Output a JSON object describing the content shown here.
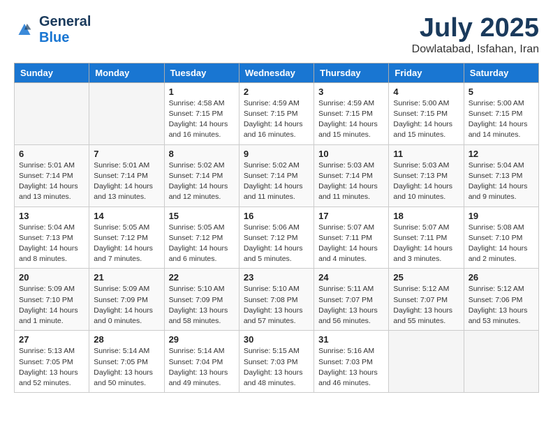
{
  "header": {
    "logo_line1": "General",
    "logo_line2": "Blue",
    "title": "July 2025",
    "subtitle": "Dowlatabad, Isfahan, Iran"
  },
  "days_of_week": [
    "Sunday",
    "Monday",
    "Tuesday",
    "Wednesday",
    "Thursday",
    "Friday",
    "Saturday"
  ],
  "weeks": [
    [
      {
        "day": "",
        "content": ""
      },
      {
        "day": "",
        "content": ""
      },
      {
        "day": "1",
        "content": "Sunrise: 4:58 AM\nSunset: 7:15 PM\nDaylight: 14 hours\nand 16 minutes."
      },
      {
        "day": "2",
        "content": "Sunrise: 4:59 AM\nSunset: 7:15 PM\nDaylight: 14 hours\nand 16 minutes."
      },
      {
        "day": "3",
        "content": "Sunrise: 4:59 AM\nSunset: 7:15 PM\nDaylight: 14 hours\nand 15 minutes."
      },
      {
        "day": "4",
        "content": "Sunrise: 5:00 AM\nSunset: 7:15 PM\nDaylight: 14 hours\nand 15 minutes."
      },
      {
        "day": "5",
        "content": "Sunrise: 5:00 AM\nSunset: 7:15 PM\nDaylight: 14 hours\nand 14 minutes."
      }
    ],
    [
      {
        "day": "6",
        "content": "Sunrise: 5:01 AM\nSunset: 7:14 PM\nDaylight: 14 hours\nand 13 minutes."
      },
      {
        "day": "7",
        "content": "Sunrise: 5:01 AM\nSunset: 7:14 PM\nDaylight: 14 hours\nand 13 minutes."
      },
      {
        "day": "8",
        "content": "Sunrise: 5:02 AM\nSunset: 7:14 PM\nDaylight: 14 hours\nand 12 minutes."
      },
      {
        "day": "9",
        "content": "Sunrise: 5:02 AM\nSunset: 7:14 PM\nDaylight: 14 hours\nand 11 minutes."
      },
      {
        "day": "10",
        "content": "Sunrise: 5:03 AM\nSunset: 7:14 PM\nDaylight: 14 hours\nand 11 minutes."
      },
      {
        "day": "11",
        "content": "Sunrise: 5:03 AM\nSunset: 7:13 PM\nDaylight: 14 hours\nand 10 minutes."
      },
      {
        "day": "12",
        "content": "Sunrise: 5:04 AM\nSunset: 7:13 PM\nDaylight: 14 hours\nand 9 minutes."
      }
    ],
    [
      {
        "day": "13",
        "content": "Sunrise: 5:04 AM\nSunset: 7:13 PM\nDaylight: 14 hours\nand 8 minutes."
      },
      {
        "day": "14",
        "content": "Sunrise: 5:05 AM\nSunset: 7:12 PM\nDaylight: 14 hours\nand 7 minutes."
      },
      {
        "day": "15",
        "content": "Sunrise: 5:05 AM\nSunset: 7:12 PM\nDaylight: 14 hours\nand 6 minutes."
      },
      {
        "day": "16",
        "content": "Sunrise: 5:06 AM\nSunset: 7:12 PM\nDaylight: 14 hours\nand 5 minutes."
      },
      {
        "day": "17",
        "content": "Sunrise: 5:07 AM\nSunset: 7:11 PM\nDaylight: 14 hours\nand 4 minutes."
      },
      {
        "day": "18",
        "content": "Sunrise: 5:07 AM\nSunset: 7:11 PM\nDaylight: 14 hours\nand 3 minutes."
      },
      {
        "day": "19",
        "content": "Sunrise: 5:08 AM\nSunset: 7:10 PM\nDaylight: 14 hours\nand 2 minutes."
      }
    ],
    [
      {
        "day": "20",
        "content": "Sunrise: 5:09 AM\nSunset: 7:10 PM\nDaylight: 14 hours\nand 1 minute."
      },
      {
        "day": "21",
        "content": "Sunrise: 5:09 AM\nSunset: 7:09 PM\nDaylight: 14 hours\nand 0 minutes."
      },
      {
        "day": "22",
        "content": "Sunrise: 5:10 AM\nSunset: 7:09 PM\nDaylight: 13 hours\nand 58 minutes."
      },
      {
        "day": "23",
        "content": "Sunrise: 5:10 AM\nSunset: 7:08 PM\nDaylight: 13 hours\nand 57 minutes."
      },
      {
        "day": "24",
        "content": "Sunrise: 5:11 AM\nSunset: 7:07 PM\nDaylight: 13 hours\nand 56 minutes."
      },
      {
        "day": "25",
        "content": "Sunrise: 5:12 AM\nSunset: 7:07 PM\nDaylight: 13 hours\nand 55 minutes."
      },
      {
        "day": "26",
        "content": "Sunrise: 5:12 AM\nSunset: 7:06 PM\nDaylight: 13 hours\nand 53 minutes."
      }
    ],
    [
      {
        "day": "27",
        "content": "Sunrise: 5:13 AM\nSunset: 7:05 PM\nDaylight: 13 hours\nand 52 minutes."
      },
      {
        "day": "28",
        "content": "Sunrise: 5:14 AM\nSunset: 7:05 PM\nDaylight: 13 hours\nand 50 minutes."
      },
      {
        "day": "29",
        "content": "Sunrise: 5:14 AM\nSunset: 7:04 PM\nDaylight: 13 hours\nand 49 minutes."
      },
      {
        "day": "30",
        "content": "Sunrise: 5:15 AM\nSunset: 7:03 PM\nDaylight: 13 hours\nand 48 minutes."
      },
      {
        "day": "31",
        "content": "Sunrise: 5:16 AM\nSunset: 7:03 PM\nDaylight: 13 hours\nand 46 minutes."
      },
      {
        "day": "",
        "content": ""
      },
      {
        "day": "",
        "content": ""
      }
    ]
  ]
}
